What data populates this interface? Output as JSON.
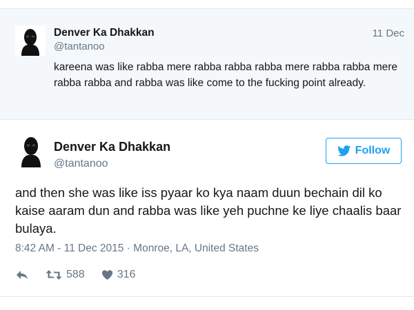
{
  "parent_tweet": {
    "name": "Denver Ka Dhakkan",
    "handle": "@tantanoo",
    "date": "11 Dec",
    "text": "kareena was like rabba mere rabba rabba rabba mere rabba rabba mere rabba rabba and rabba was like come to the fucking point already."
  },
  "main_tweet": {
    "name": "Denver Ka Dhakkan",
    "handle": "@tantanoo",
    "follow_label": "Follow",
    "text": "and then she was like iss pyaar ko kya naam duun bechain dil ko kaise aaram dun and rabba was like yeh puchne ke liye chaalis baar bulaya.",
    "meta": "8:42 AM - 11 Dec 2015 · Monroe, LA, United States",
    "retweets": "588",
    "likes": "316"
  },
  "colors": {
    "accent": "#1da1f2",
    "muted": "#657786",
    "parent_bg": "#f5f8fa",
    "border": "#e1e8ed"
  },
  "icons": {
    "follow": "twitter-bird-icon",
    "reply": "reply-icon",
    "retweet": "retweet-icon",
    "like": "heart-icon"
  }
}
